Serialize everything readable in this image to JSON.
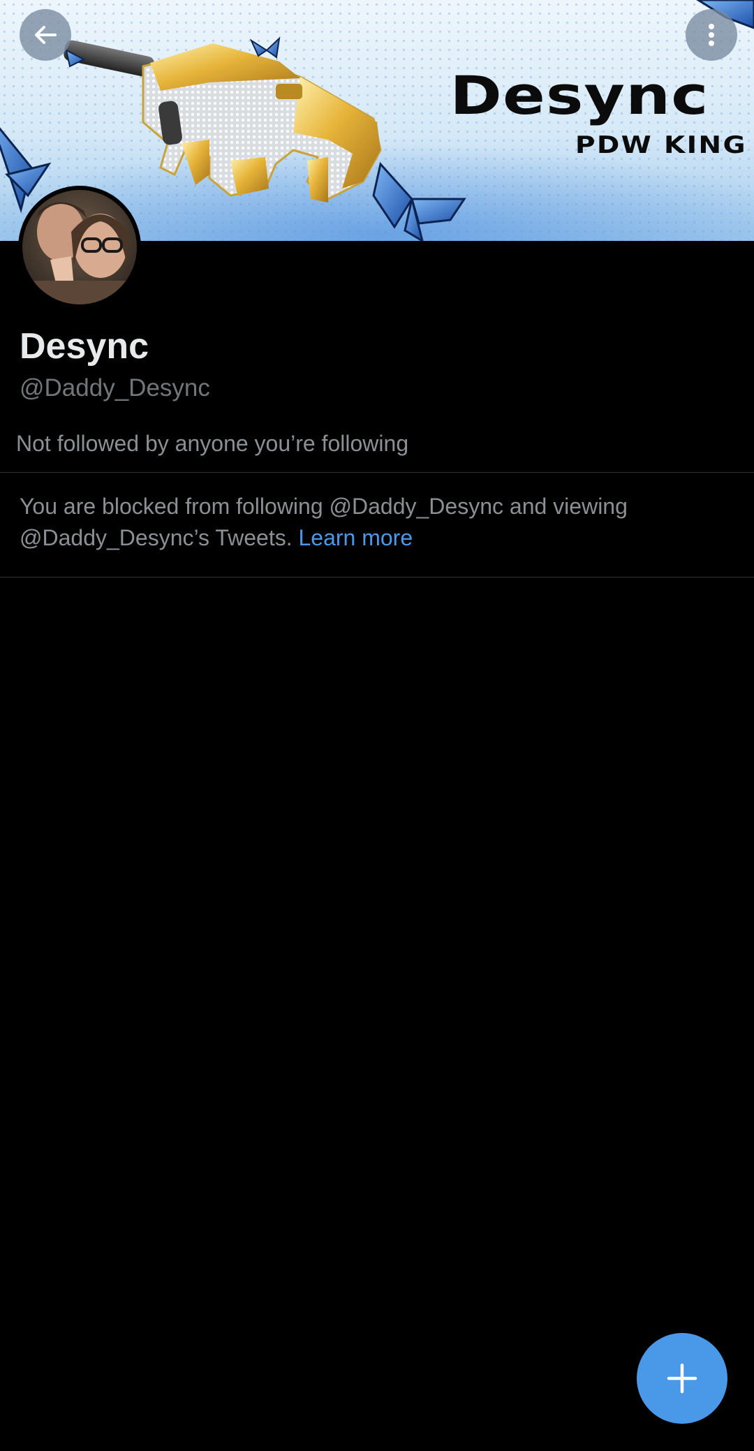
{
  "banner": {
    "title": "Desync",
    "subtitle": "PDW KING"
  },
  "nav": {
    "back_icon": "arrow-left-icon",
    "more_icon": "vertical-ellipsis-icon"
  },
  "profile": {
    "display_name": "Desync",
    "handle": "@Daddy_Desync",
    "follow_context": "Not followed by anyone you’re following"
  },
  "blocked": {
    "message": "You are blocked from following @Daddy_Desync and viewing @Daddy_Desync’s Tweets.",
    "link_label": "Learn more"
  },
  "fab": {
    "icon": "plus-icon"
  },
  "colors": {
    "background": "#000000",
    "accent": "#4a99e9",
    "secondary_text": "#71767b",
    "divider": "#2f3336"
  }
}
